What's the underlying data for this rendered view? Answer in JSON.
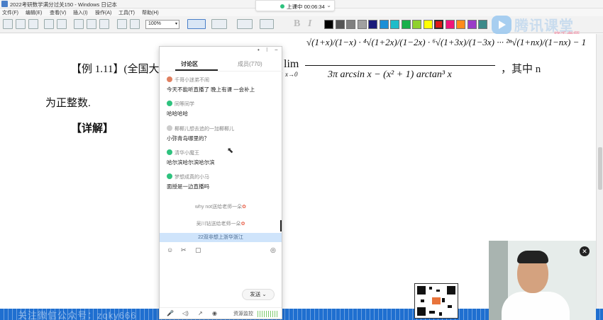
{
  "window": {
    "title": "2022考研数学满分过关150 - Windows 日记本"
  },
  "menu": [
    "文件(F)",
    "编辑(E)",
    "查看(V)",
    "插入(I)",
    "操作(A)",
    "工具(T)",
    "帮助(H)"
  ],
  "toolbar": {
    "zoom": "100%",
    "zoom_arrow": "▾",
    "bold": "B",
    "italic": "I"
  },
  "colors": [
    "#000000",
    "#555555",
    "#808080",
    "#a0a0a0",
    "#1a1a7a",
    "#1a8fd6",
    "#1fbcc9",
    "#18b04a",
    "#8fd12e",
    "#ffff00",
    "#e01818",
    "#f0147a",
    "#ff8c1a",
    "#9a3cc8",
    "#3c8a8a"
  ],
  "live": {
    "status": "上课中 00:06:34",
    "chevron": "⌄"
  },
  "brand": {
    "name": "腾讯课堂",
    "sub": "晓千老师"
  },
  "document": {
    "example": "【例 1.11】(全国大学",
    "lim": "lim",
    "lim_sub": "x→0",
    "numerator": "√(1+x)/(1−x) · ⁴√(1+2x)/(1−2x) · ⁶√(1+3x)/(1−3x) ··· ²ⁿ√(1+nx)/(1−nx) − 1",
    "denominator": "3π arcsin x − (x² + 1) arctan³ x",
    "tail": "，其中 n",
    "line2": "为正整数.",
    "answer": "【详解】"
  },
  "chat": {
    "header": {
      "pin": "•",
      "more": "⁝",
      "min": "−"
    },
    "tab_discuss": "讨论区",
    "tab_members": "成员(770)",
    "messages": [
      {
        "name": "千哥小迷弟不闹",
        "text": "今天不能听直播了 晚上有课 一会补上",
        "color": "#e08060"
      },
      {
        "name": "同等同学",
        "text": "哈哈哈哈",
        "color": "#2ec27e"
      },
      {
        "name": "椰椰儿想去追的一加椰椰儿",
        "text": "小弥青岛哪里的？",
        "color": "#cccccc"
      },
      {
        "name": "清华小魔王",
        "text": "哈尔滨哈尔滨哈尔滨",
        "color": "#2ec27e"
      },
      {
        "name": "梦想成真的小马",
        "text": "面授是一边直播吗",
        "color": "#2ec27e"
      }
    ],
    "system": [
      "why not送给老师一朵",
      "吴川钻送给老师一朵",
      "22双非想上浙华浙江"
    ],
    "flower": "✿",
    "icons": [
      "☺",
      "✂",
      "▢",
      "◎"
    ],
    "send": "发送",
    "send_arrow": "⌄",
    "foot_icons": [
      "🎤",
      "◁)",
      "↗",
      "◉"
    ],
    "foot_label": "资源监控"
  },
  "bottom": {
    "watermark": "关注微信公众号：zqky666"
  },
  "camera": {
    "close": "✕"
  }
}
